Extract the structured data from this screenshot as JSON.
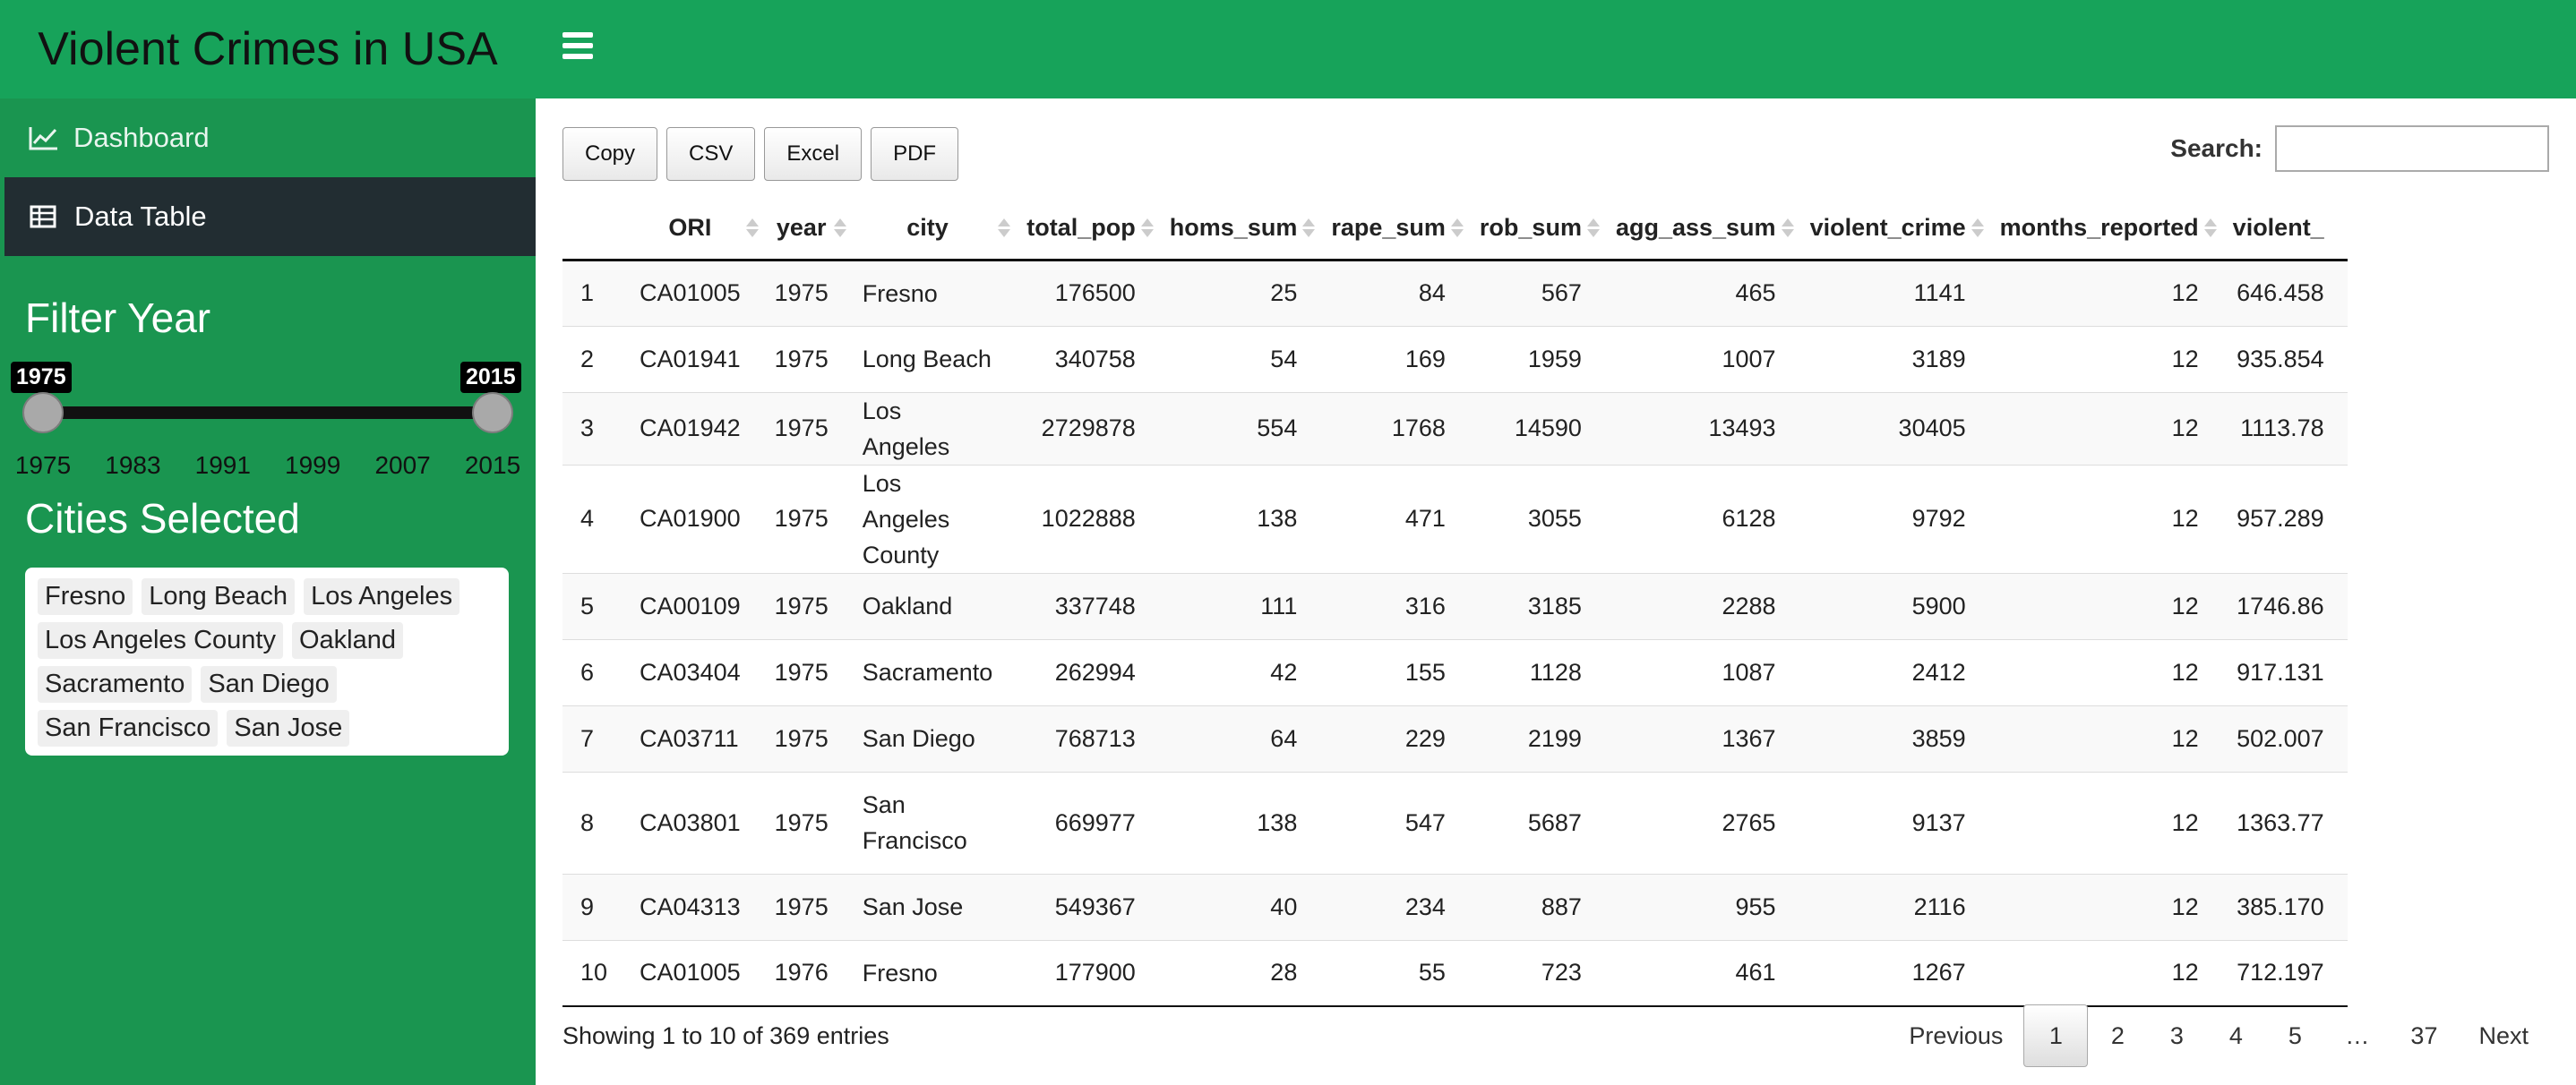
{
  "app": {
    "title": "Violent Crimes in USA"
  },
  "sidebar": {
    "menu": [
      {
        "label": "Dashboard",
        "icon": "line-chart-icon",
        "active": false
      },
      {
        "label": "Data Table",
        "icon": "table-icon",
        "active": true
      }
    ],
    "filter_heading": "Filter Year",
    "slider": {
      "min": 1975,
      "max": 2015,
      "from": 1975,
      "to": 2015,
      "from_label": "1975",
      "to_label": "2015",
      "ticks": [
        "1975",
        "1983",
        "1991",
        "1999",
        "2007",
        "2015"
      ]
    },
    "cities_heading": "Cities Selected",
    "cities": [
      "Fresno",
      "Long Beach",
      "Los Angeles",
      "Los Angeles County",
      "Oakland",
      "Sacramento",
      "San Diego",
      "San Francisco",
      "San Jose"
    ]
  },
  "colors": {
    "header": "#17a35a",
    "sidebar": "#1a9550",
    "active_menu": "#222d32"
  },
  "toolbar": {
    "buttons": [
      "Copy",
      "CSV",
      "Excel",
      "PDF"
    ],
    "search_label": "Search:",
    "search_value": ""
  },
  "table": {
    "columns": [
      "",
      "ORI",
      "year",
      "city",
      "total_pop",
      "homs_sum",
      "rape_sum",
      "rob_sum",
      "agg_ass_sum",
      "violent_crime",
      "months_reported",
      "violent_"
    ],
    "rows": [
      [
        "1",
        "CA01005",
        "1975",
        "Fresno",
        "176500",
        "25",
        "84",
        "567",
        "465",
        "1141",
        "12",
        "646.458"
      ],
      [
        "2",
        "CA01941",
        "1975",
        "Long Beach",
        "340758",
        "54",
        "169",
        "1959",
        "1007",
        "3189",
        "12",
        "935.854"
      ],
      [
        "3",
        "CA01942",
        "1975",
        "Los Angeles",
        "2729878",
        "554",
        "1768",
        "14590",
        "13493",
        "30405",
        "12",
        "1113.78"
      ],
      [
        "4",
        "CA01900",
        "1975",
        "Los Angeles County",
        "1022888",
        "138",
        "471",
        "3055",
        "6128",
        "9792",
        "12",
        "957.289"
      ],
      [
        "5",
        "CA00109",
        "1975",
        "Oakland",
        "337748",
        "111",
        "316",
        "3185",
        "2288",
        "5900",
        "12",
        "1746.86"
      ],
      [
        "6",
        "CA03404",
        "1975",
        "Sacramento",
        "262994",
        "42",
        "155",
        "1128",
        "1087",
        "2412",
        "12",
        "917.131"
      ],
      [
        "7",
        "CA03711",
        "1975",
        "San Diego",
        "768713",
        "64",
        "229",
        "2199",
        "1367",
        "3859",
        "12",
        "502.007"
      ],
      [
        "8",
        "CA03801",
        "1975",
        "San Francisco",
        "669977",
        "138",
        "547",
        "5687",
        "2765",
        "9137",
        "12",
        "1363.77"
      ],
      [
        "9",
        "CA04313",
        "1975",
        "San Jose",
        "549367",
        "40",
        "234",
        "887",
        "955",
        "2116",
        "12",
        "385.170"
      ],
      [
        "10",
        "CA01005",
        "1976",
        "Fresno",
        "177900",
        "28",
        "55",
        "723",
        "461",
        "1267",
        "12",
        "712.197"
      ]
    ],
    "info": "Showing 1 to 10 of 369 entries"
  },
  "pagination": {
    "previous": "Previous",
    "pages": [
      "1",
      "2",
      "3",
      "4",
      "5",
      "…",
      "37"
    ],
    "current": "1",
    "next": "Next"
  }
}
